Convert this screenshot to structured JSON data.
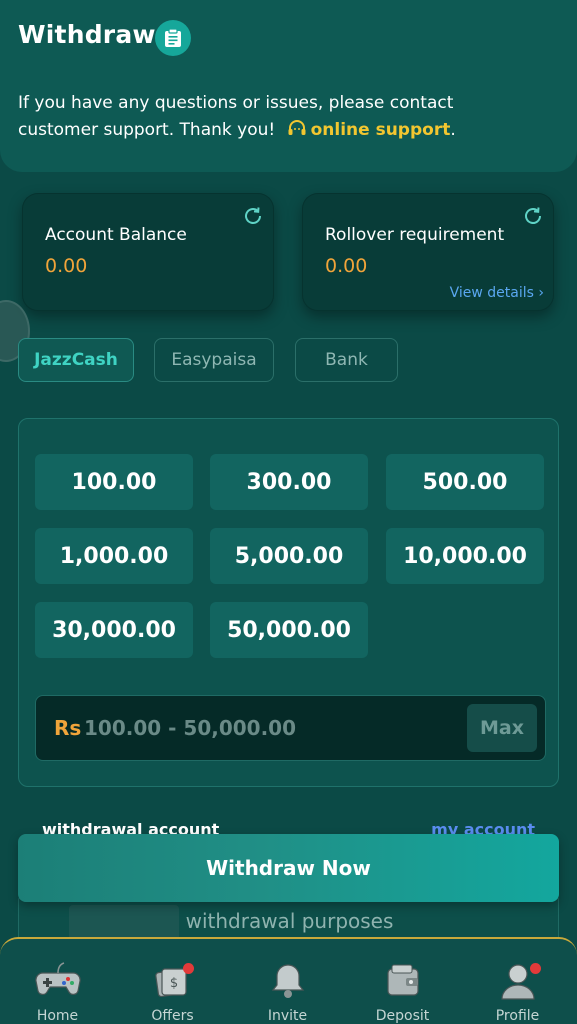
{
  "header": {
    "title": "Withdraw",
    "message": "If you have any questions or issues, please contact customer support. Thank you!",
    "support_link": "online support",
    "support_suffix": "."
  },
  "balances": {
    "account": {
      "label": "Account Balance",
      "value": "0.00"
    },
    "rollover": {
      "label": "Rollover requirement",
      "value": "0.00",
      "details": "View details"
    }
  },
  "methods": {
    "items": [
      "JazzCash",
      "Easypaisa",
      "Bank"
    ],
    "selected": "JazzCash"
  },
  "amounts": [
    "100.00",
    "300.00",
    "500.00",
    "1,000.00",
    "5,000.00",
    "10,000.00",
    "30,000.00",
    "50,000.00"
  ],
  "amount_input": {
    "currency": "Rs",
    "placeholder": "100.00 - 50,000.00",
    "max_label": "Max"
  },
  "withdrawal_account": {
    "label": "withdrawal account",
    "link": "my account",
    "purpose_text": "withdrawal purposes"
  },
  "withdraw_button": "Withdraw Now",
  "nav": {
    "items": [
      "Home",
      "Offers",
      "Invite",
      "Deposit",
      "Profile"
    ]
  },
  "colors": {
    "accent": "#16a79a",
    "highlight": "#f2c630",
    "value": "#f0a43a",
    "link": "#5aa7f0",
    "badge": "#e23a3a"
  }
}
